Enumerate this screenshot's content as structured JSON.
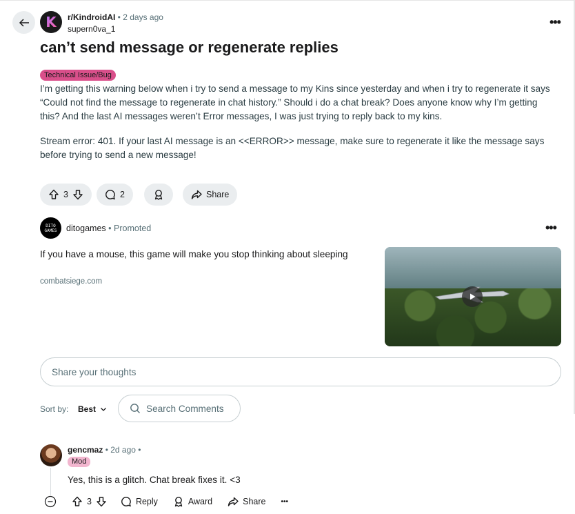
{
  "header": {
    "subreddit": "r/KindroidAI",
    "separator": "•",
    "time_ago": "2 days ago",
    "author": "supern0va_1",
    "avatar_letter": "K"
  },
  "post": {
    "title": "can’t send message or regenerate replies",
    "flair": "Technical Issue/Bug",
    "paragraph1": "I’m getting this warning below when i try to send a message to my Kins since yesterday and when i try to regenerate it says “Could not find the message to regenerate in chat history.” Should i do a chat break? Does anyone know why I’m getting this? And the last AI messages weren’t Error messages, I was just trying to reply back to my kins.",
    "paragraph2": "Stream error: 401. If your last AI message is an <<ERROR>> message, make sure to regenerate it like the message says before trying to send a new message!"
  },
  "actions": {
    "upvotes": "3",
    "comments": "2",
    "share_label": "Share"
  },
  "ad": {
    "avatar_text": "DITO GAMES",
    "advertiser": "ditogames",
    "separator": "•",
    "promoted_label": "Promoted",
    "text": "If you have a mouse, this game will make you stop thinking about sleeping",
    "domain": "combatsiege.com"
  },
  "comment_input": {
    "placeholder": "Share your thoughts"
  },
  "sort": {
    "label": "Sort by:",
    "value": "Best"
  },
  "search_comments": {
    "placeholder": "Search Comments"
  },
  "comment": {
    "username": "gencmaz",
    "time_ago": "2d ago",
    "separator": "•",
    "flair": "Mod",
    "body": "Yes, this is a glitch. Chat break fixes it. <3",
    "votes": "3",
    "reply_label": "Reply",
    "award_label": "Award",
    "share_label": "Share",
    "more_label": "•••"
  },
  "colors": {
    "flair_bg": "#d94f8a",
    "mod_flair_bg": "#f2b6cf",
    "pill_bg": "#eaedef"
  }
}
